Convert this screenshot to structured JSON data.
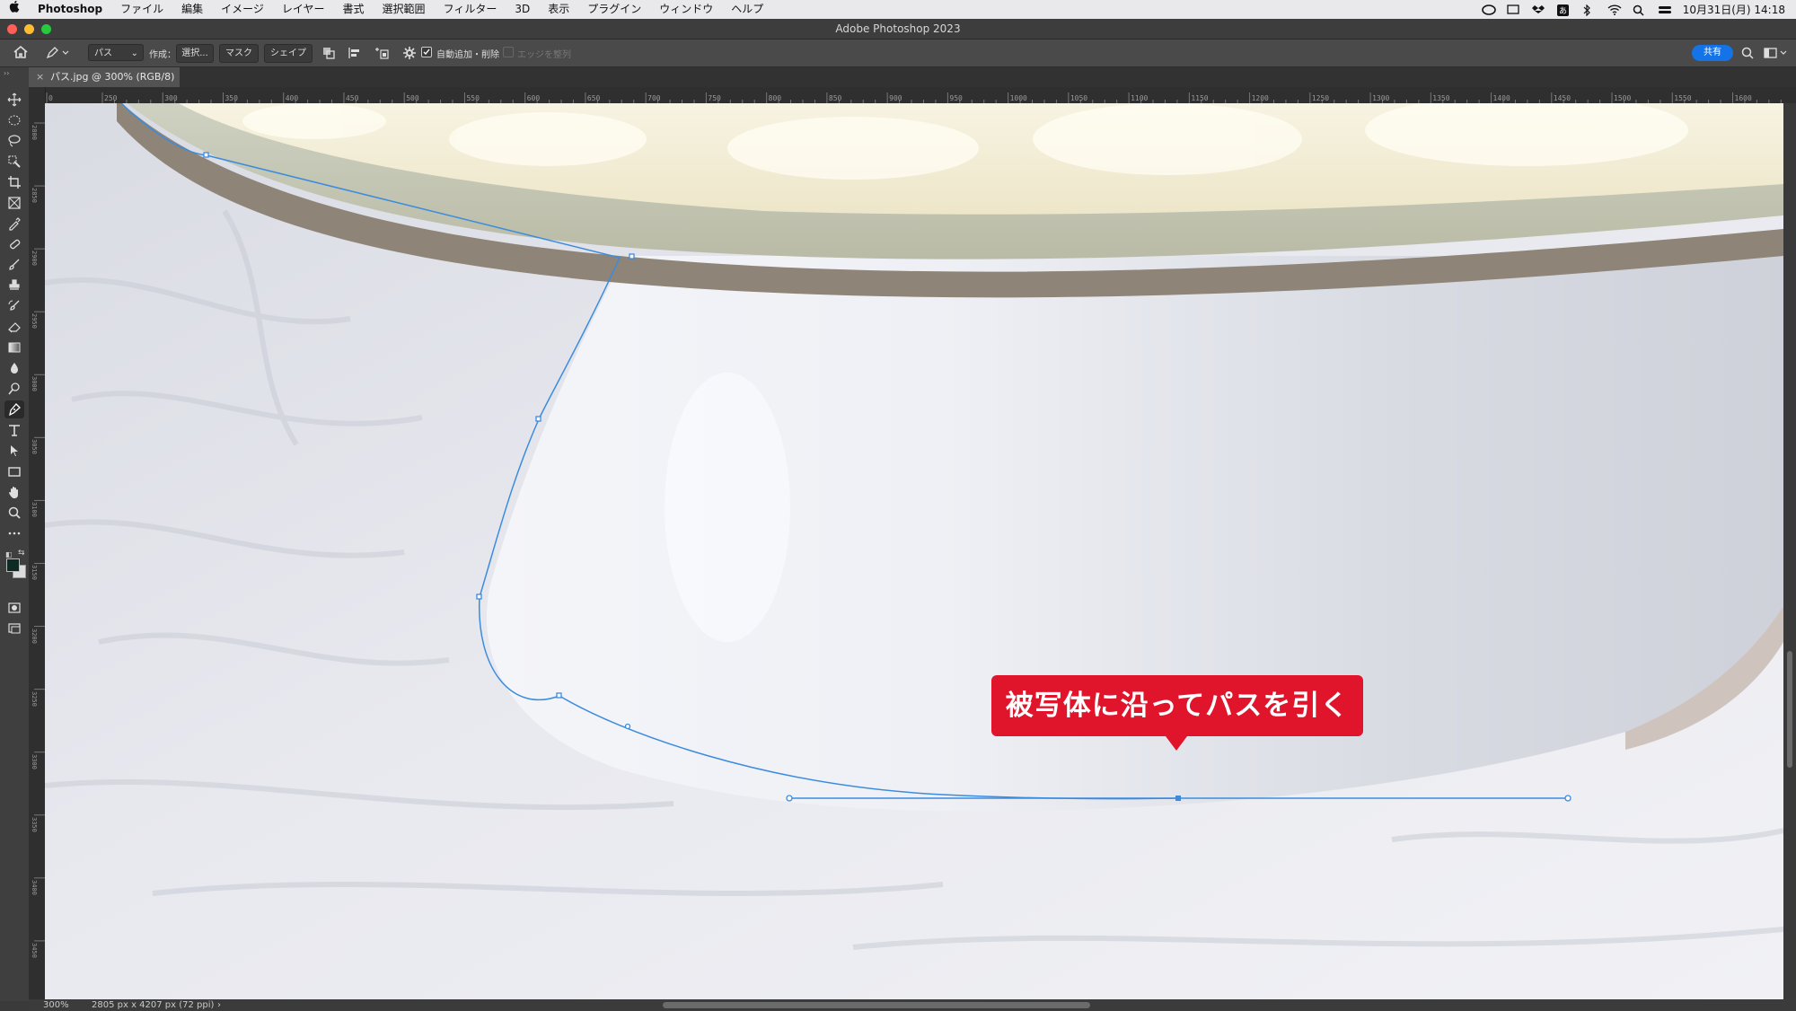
{
  "menubar": {
    "apple_icon": "apple-icon",
    "app_name": "Photoshop",
    "items": [
      "ファイル",
      "編集",
      "イメージ",
      "レイヤー",
      "書式",
      "選択範囲",
      "フィルター",
      "3D",
      "表示",
      "プラグイン",
      "ウィンドウ",
      "ヘルプ"
    ],
    "clock": "10月31日(月)  14:18"
  },
  "window": {
    "title": "Adobe Photoshop 2023"
  },
  "options": {
    "tool_mode": "パス",
    "make_label": "作成：",
    "selection_btn": "選択...",
    "mask_btn": "マスク",
    "shape_btn": "シェイプ",
    "auto_add_delete": "自動追加・削除",
    "align_edges": "エッジを整列",
    "share_btn": "共有"
  },
  "document": {
    "tab_title": "パス.jpg @ 300% (RGB/8) *",
    "zoom": "300%",
    "dimensions": "2805 px x 4207 px (72 ppi)"
  },
  "rulers": {
    "horizontal": [
      "0",
      "250",
      "300",
      "350",
      "400",
      "450",
      "500",
      "550",
      "600",
      "650",
      "700",
      "750",
      "800",
      "850",
      "900",
      "950",
      "1000",
      "1050",
      "1100",
      "1150",
      "1200",
      "1250",
      "1300",
      "1350",
      "1400",
      "1450",
      "1500",
      "1550",
      "1600"
    ],
    "vertical": [
      "2800",
      "2850",
      "2900",
      "2950",
      "3000",
      "3050",
      "3100",
      "3150",
      "3200",
      "3250",
      "3300",
      "3350",
      "3400",
      "3450"
    ]
  },
  "callout": {
    "text": "被写体に沿ってパスを引く",
    "color": "#e0142b"
  },
  "colors": {
    "path_line": "#3b8bde",
    "accent": "#1473e6"
  }
}
